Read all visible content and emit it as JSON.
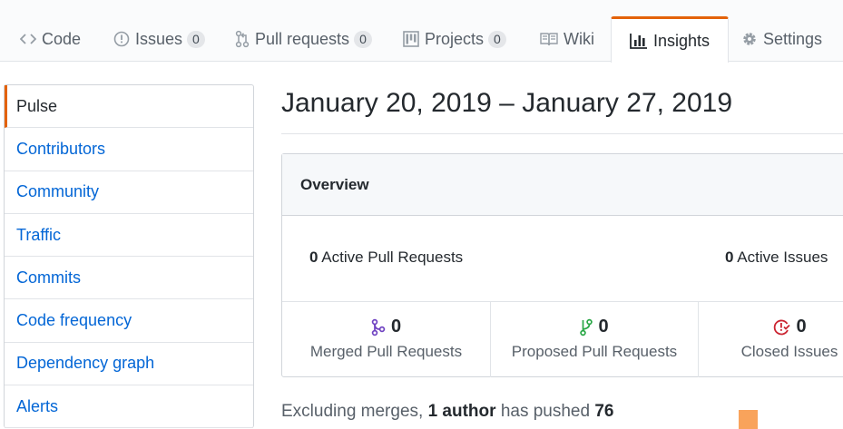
{
  "tabs": [
    {
      "label": "Code",
      "icon": "code-icon"
    },
    {
      "label": "Issues",
      "icon": "issue-opened-icon",
      "count": "0"
    },
    {
      "label": "Pull requests",
      "icon": "git-pull-request-icon",
      "count": "0"
    },
    {
      "label": "Projects",
      "icon": "project-icon",
      "count": "0"
    },
    {
      "label": "Wiki",
      "icon": "book-icon"
    },
    {
      "label": "Insights",
      "icon": "graph-icon",
      "selected": true
    },
    {
      "label": "Settings",
      "icon": "gear-icon"
    }
  ],
  "sidebar": {
    "items": [
      {
        "label": "Pulse",
        "selected": true
      },
      {
        "label": "Contributors"
      },
      {
        "label": "Community"
      },
      {
        "label": "Traffic"
      },
      {
        "label": "Commits"
      },
      {
        "label": "Code frequency"
      },
      {
        "label": "Dependency graph"
      },
      {
        "label": "Alerts"
      }
    ]
  },
  "main": {
    "date_range": "January 20, 2019 – January 27, 2019",
    "overview": {
      "title": "Overview",
      "active_prs": {
        "count": "0",
        "label": "Active Pull Requests"
      },
      "active_issues": {
        "count": "0",
        "label": "Active Issues"
      },
      "stats": [
        {
          "count": "0",
          "label": "Merged Pull Requests",
          "icon": "git-merge-icon",
          "color": "#6f42c1"
        },
        {
          "count": "0",
          "label": "Proposed Pull Requests",
          "icon": "git-branch-icon",
          "color": "#28a745"
        },
        {
          "count": "0",
          "label": "Closed Issues",
          "icon": "issue-closed-icon",
          "color": "#cb2431"
        }
      ]
    },
    "summary": {
      "prefix": "Excluding merges,",
      "author": "1 author",
      "middle": "has pushed",
      "commits": "76"
    }
  },
  "colors": {
    "accent": "#e36209",
    "link": "#0366d6",
    "chart_orange": "#f9a35b"
  }
}
